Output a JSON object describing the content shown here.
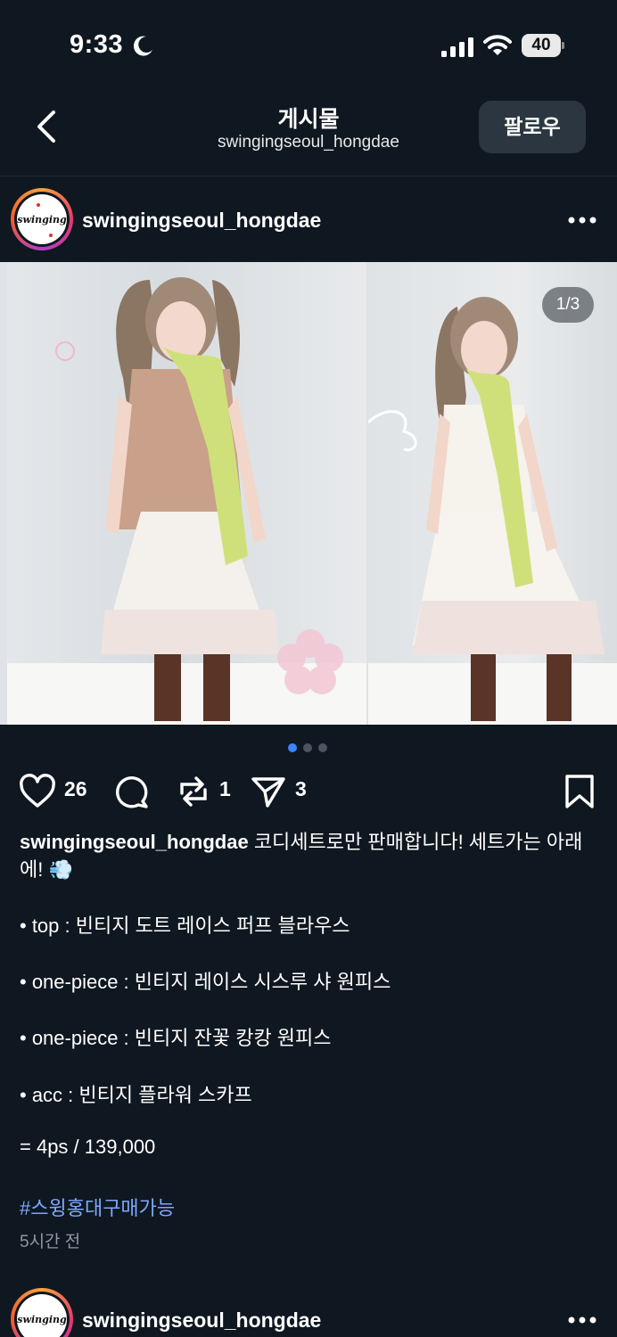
{
  "status_bar": {
    "time": "9:33",
    "battery": "40"
  },
  "header": {
    "title": "게시물",
    "subtitle": "swingingseoul_hongdae",
    "follow_label": "팔로우"
  },
  "post": {
    "username": "swingingseoul_hongdae",
    "avatar_text": "swinging",
    "page_indicator": "1/3",
    "carousel": {
      "total": 3,
      "current": 1
    },
    "likes": "26",
    "reposts": "1",
    "shares": "3",
    "caption_user": "swingingseoul_hongdae",
    "caption_text": "코디세트로만 판매합니다! 세트가는 아래에! 💨",
    "lines": [
      "• top : 빈티지 도트 레이스 퍼프 블라우스",
      "• one-piece : 빈티지 레이스 시스루 샤 원피스",
      "• one-piece : 빈티지 잔꽃 캉캉 원피스",
      "• acc : 빈티지 플라워 스카프",
      "= 4ps / 139,000"
    ],
    "hashtag": "#스윙홍대구매가능",
    "time_ago": "5시간 전"
  },
  "next_post": {
    "username": "swingingseoul_hongdae",
    "avatar_text": "swinging"
  },
  "colors": {
    "background": "#0f1720",
    "follow_button": "#2b3640",
    "hashtag": "#7ea7ff",
    "active_dot": "#3a86ff",
    "muted_text": "#8b98a5"
  }
}
